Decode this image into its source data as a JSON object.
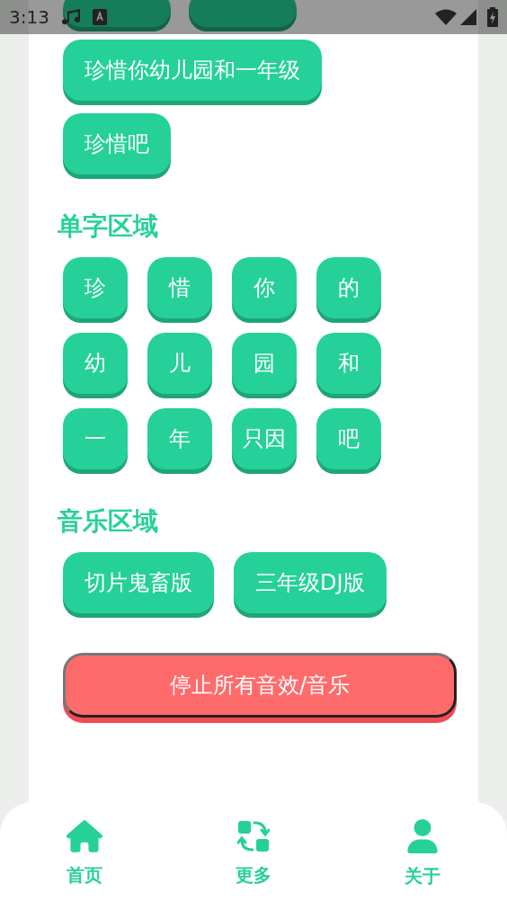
{
  "status_bar": {
    "time": "3:13"
  },
  "phrases": [
    "珍惜你幼儿园和一年级",
    "珍惜吧"
  ],
  "sections": [
    {
      "title": "单字区域",
      "kind": "grid",
      "buttons": [
        "珍",
        "惜",
        "你",
        "的",
        "幼",
        "儿",
        "园",
        "和",
        "一",
        "年",
        "只因",
        "吧"
      ]
    },
    {
      "title": "音乐区域",
      "kind": "wrap",
      "buttons": [
        "切片鬼畜版",
        "三年级DJ版"
      ]
    }
  ],
  "stop_button": "停止所有音效/音乐",
  "nav": [
    {
      "label": "首页",
      "kind": "home"
    },
    {
      "label": "更多",
      "kind": "swap"
    },
    {
      "label": "关于",
      "kind": "person"
    }
  ]
}
